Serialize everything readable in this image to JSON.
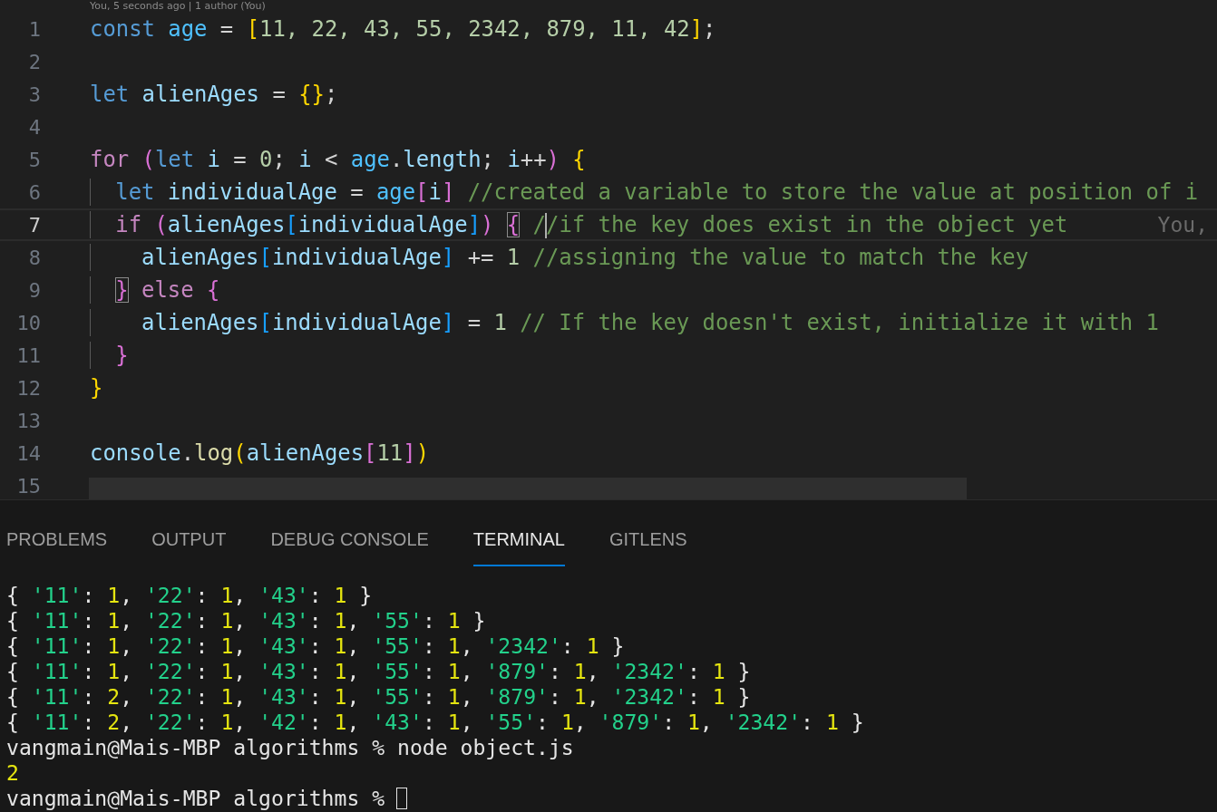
{
  "editor": {
    "codelens": "You, 5 seconds ago | 1 author (You)",
    "lines": [
      {
        "number": "1",
        "active": false,
        "tokens": [
          {
            "text": "const",
            "kind": "keyword"
          },
          {
            "text": " age",
            "kind": "constant"
          },
          {
            "text": " = ",
            "kind": "plain"
          },
          {
            "text": "[",
            "kind": "bracket1"
          },
          {
            "text": "11, 22, 43, 55, 2342, 879, 11, 42",
            "kind": "number"
          },
          {
            "text": "]",
            "kind": "bracket1"
          },
          {
            "text": ";",
            "kind": "plain"
          }
        ]
      },
      {
        "number": "2",
        "active": false
      },
      {
        "number": "3",
        "active": false,
        "tokens": [
          {
            "text": "let",
            "kind": "keyword"
          },
          {
            "text": " alienAges",
            "kind": "variable"
          },
          {
            "text": " = ",
            "kind": "plain"
          },
          {
            "text": "{}",
            "kind": "bracket1"
          },
          {
            "text": ";",
            "kind": "plain"
          }
        ]
      },
      {
        "number": "4",
        "active": false
      },
      {
        "number": "5",
        "active": false,
        "tokens": [
          {
            "text": "for",
            "kind": "control"
          },
          {
            "text": " (",
            "kind": "bracket2"
          },
          {
            "text": "let",
            "kind": "keyword"
          },
          {
            "text": " i",
            "kind": "variable"
          },
          {
            "text": " = ",
            "kind": "plain"
          },
          {
            "text": "0",
            "kind": "number"
          },
          {
            "text": "; ",
            "kind": "plain"
          },
          {
            "text": "i",
            "kind": "variable"
          },
          {
            "text": " < ",
            "kind": "plain"
          },
          {
            "text": "age",
            "kind": "constant"
          },
          {
            "text": ".",
            "kind": "plain"
          },
          {
            "text": "length",
            "kind": "variable"
          },
          {
            "text": "; ",
            "kind": "plain"
          },
          {
            "text": "i",
            "kind": "variable"
          },
          {
            "text": "++",
            "kind": "plain"
          },
          {
            "text": ")",
            "kind": "bracket2"
          },
          {
            "text": " {",
            "kind": "bracket1"
          }
        ]
      },
      {
        "number": "6",
        "active": false,
        "guide": true,
        "tokens": [
          {
            "text": "let",
            "kind": "keyword"
          },
          {
            "text": " individualAge",
            "kind": "variable"
          },
          {
            "text": " = ",
            "kind": "plain"
          },
          {
            "text": "age",
            "kind": "constant"
          },
          {
            "text": "[",
            "kind": "bracket2"
          },
          {
            "text": "i",
            "kind": "variable"
          },
          {
            "text": "]",
            "kind": "bracket2"
          },
          {
            "text": " //created a variable to store the value at position of i",
            "kind": "comment"
          }
        ]
      },
      {
        "number": "7",
        "active": true,
        "guide": true,
        "blame": "You,",
        "tokens": [
          {
            "text": "if",
            "kind": "control"
          },
          {
            "text": " (",
            "kind": "bracket2"
          },
          {
            "text": "alienAges",
            "kind": "variable"
          },
          {
            "text": "[",
            "kind": "bracket3"
          },
          {
            "text": "individualAge",
            "kind": "variable"
          },
          {
            "text": "]",
            "kind": "bracket3"
          },
          {
            "text": ") ",
            "kind": "bracket2"
          },
          {
            "text": "{",
            "kind": "bracket2",
            "matched": true
          },
          {
            "text": " /",
            "kind": "comment",
            "cursor_after": true
          },
          {
            "text": "/if the key does exist in the object yet",
            "kind": "comment"
          }
        ]
      },
      {
        "number": "8",
        "active": false,
        "guide": true,
        "tokens": [
          {
            "text": "  alienAges",
            "kind": "variable"
          },
          {
            "text": "[",
            "kind": "bracket3"
          },
          {
            "text": "individualAge",
            "kind": "variable"
          },
          {
            "text": "]",
            "kind": "bracket3"
          },
          {
            "text": " += ",
            "kind": "plain"
          },
          {
            "text": "1",
            "kind": "number"
          },
          {
            "text": " //assigning the value to match the key",
            "kind": "comment"
          }
        ]
      },
      {
        "number": "9",
        "active": false,
        "guide": true,
        "tokens": [
          {
            "text": "}",
            "kind": "bracket2",
            "matched": true
          },
          {
            "text": " else",
            "kind": "control"
          },
          {
            "text": " {",
            "kind": "bracket2"
          }
        ]
      },
      {
        "number": "10",
        "active": false,
        "guide": true,
        "tokens": [
          {
            "text": "  alienAges",
            "kind": "variable"
          },
          {
            "text": "[",
            "kind": "bracket3"
          },
          {
            "text": "individualAge",
            "kind": "variable"
          },
          {
            "text": "]",
            "kind": "bracket3"
          },
          {
            "text": " = ",
            "kind": "plain"
          },
          {
            "text": "1",
            "kind": "number"
          },
          {
            "text": " // If the key doesn't exist, initialize it with 1",
            "kind": "comment"
          }
        ]
      },
      {
        "number": "11",
        "active": false,
        "guide": true,
        "tokens": [
          {
            "text": "}",
            "kind": "bracket2"
          }
        ]
      },
      {
        "number": "12",
        "active": false,
        "tokens": [
          {
            "text": "}",
            "kind": "bracket1"
          }
        ]
      },
      {
        "number": "13",
        "active": false
      },
      {
        "number": "14",
        "active": false,
        "tokens": [
          {
            "text": "console",
            "kind": "variable"
          },
          {
            "text": ".",
            "kind": "plain"
          },
          {
            "text": "log",
            "kind": "function"
          },
          {
            "text": "(",
            "kind": "bracket1"
          },
          {
            "text": "alienAges",
            "kind": "variable"
          },
          {
            "text": "[",
            "kind": "bracket2"
          },
          {
            "text": "11",
            "kind": "number"
          },
          {
            "text": "]",
            "kind": "bracket2"
          },
          {
            "text": ")",
            "kind": "bracket1"
          }
        ]
      },
      {
        "number": "15",
        "active": false
      }
    ]
  },
  "panel": {
    "tabs": [
      {
        "label": "PROBLEMS",
        "selected": false
      },
      {
        "label": "OUTPUT",
        "selected": false
      },
      {
        "label": "DEBUG CONSOLE",
        "selected": false
      },
      {
        "label": "TERMINAL",
        "selected": true
      },
      {
        "label": "GITLENS",
        "selected": false
      }
    ],
    "terminal": [
      {
        "tokens": [
          {
            "text": "{ ",
            "kind": "plain"
          },
          {
            "text": "'11'",
            "kind": "string"
          },
          {
            "text": ": ",
            "kind": "plain"
          },
          {
            "text": "1",
            "kind": "number"
          },
          {
            "text": ", ",
            "kind": "plain"
          },
          {
            "text": "'22'",
            "kind": "string"
          },
          {
            "text": ": ",
            "kind": "plain"
          },
          {
            "text": "1",
            "kind": "number"
          },
          {
            "text": ", ",
            "kind": "plain"
          },
          {
            "text": "'43'",
            "kind": "string"
          },
          {
            "text": ": ",
            "kind": "plain"
          },
          {
            "text": "1",
            "kind": "number"
          },
          {
            "text": " }",
            "kind": "plain"
          }
        ]
      },
      {
        "tokens": [
          {
            "text": "{ ",
            "kind": "plain"
          },
          {
            "text": "'11'",
            "kind": "string"
          },
          {
            "text": ": ",
            "kind": "plain"
          },
          {
            "text": "1",
            "kind": "number"
          },
          {
            "text": ", ",
            "kind": "plain"
          },
          {
            "text": "'22'",
            "kind": "string"
          },
          {
            "text": ": ",
            "kind": "plain"
          },
          {
            "text": "1",
            "kind": "number"
          },
          {
            "text": ", ",
            "kind": "plain"
          },
          {
            "text": "'43'",
            "kind": "string"
          },
          {
            "text": ": ",
            "kind": "plain"
          },
          {
            "text": "1",
            "kind": "number"
          },
          {
            "text": ", ",
            "kind": "plain"
          },
          {
            "text": "'55'",
            "kind": "string"
          },
          {
            "text": ": ",
            "kind": "plain"
          },
          {
            "text": "1",
            "kind": "number"
          },
          {
            "text": " }",
            "kind": "plain"
          }
        ]
      },
      {
        "tokens": [
          {
            "text": "{ ",
            "kind": "plain"
          },
          {
            "text": "'11'",
            "kind": "string"
          },
          {
            "text": ": ",
            "kind": "plain"
          },
          {
            "text": "1",
            "kind": "number"
          },
          {
            "text": ", ",
            "kind": "plain"
          },
          {
            "text": "'22'",
            "kind": "string"
          },
          {
            "text": ": ",
            "kind": "plain"
          },
          {
            "text": "1",
            "kind": "number"
          },
          {
            "text": ", ",
            "kind": "plain"
          },
          {
            "text": "'43'",
            "kind": "string"
          },
          {
            "text": ": ",
            "kind": "plain"
          },
          {
            "text": "1",
            "kind": "number"
          },
          {
            "text": ", ",
            "kind": "plain"
          },
          {
            "text": "'55'",
            "kind": "string"
          },
          {
            "text": ": ",
            "kind": "plain"
          },
          {
            "text": "1",
            "kind": "number"
          },
          {
            "text": ", ",
            "kind": "plain"
          },
          {
            "text": "'2342'",
            "kind": "string"
          },
          {
            "text": ": ",
            "kind": "plain"
          },
          {
            "text": "1",
            "kind": "number"
          },
          {
            "text": " }",
            "kind": "plain"
          }
        ]
      },
      {
        "tokens": [
          {
            "text": "{ ",
            "kind": "plain"
          },
          {
            "text": "'11'",
            "kind": "string"
          },
          {
            "text": ": ",
            "kind": "plain"
          },
          {
            "text": "1",
            "kind": "number"
          },
          {
            "text": ", ",
            "kind": "plain"
          },
          {
            "text": "'22'",
            "kind": "string"
          },
          {
            "text": ": ",
            "kind": "plain"
          },
          {
            "text": "1",
            "kind": "number"
          },
          {
            "text": ", ",
            "kind": "plain"
          },
          {
            "text": "'43'",
            "kind": "string"
          },
          {
            "text": ": ",
            "kind": "plain"
          },
          {
            "text": "1",
            "kind": "number"
          },
          {
            "text": ", ",
            "kind": "plain"
          },
          {
            "text": "'55'",
            "kind": "string"
          },
          {
            "text": ": ",
            "kind": "plain"
          },
          {
            "text": "1",
            "kind": "number"
          },
          {
            "text": ", ",
            "kind": "plain"
          },
          {
            "text": "'879'",
            "kind": "string"
          },
          {
            "text": ": ",
            "kind": "plain"
          },
          {
            "text": "1",
            "kind": "number"
          },
          {
            "text": ", ",
            "kind": "plain"
          },
          {
            "text": "'2342'",
            "kind": "string"
          },
          {
            "text": ": ",
            "kind": "plain"
          },
          {
            "text": "1",
            "kind": "number"
          },
          {
            "text": " }",
            "kind": "plain"
          }
        ]
      },
      {
        "tokens": [
          {
            "text": "{ ",
            "kind": "plain"
          },
          {
            "text": "'11'",
            "kind": "string"
          },
          {
            "text": ": ",
            "kind": "plain"
          },
          {
            "text": "2",
            "kind": "number"
          },
          {
            "text": ", ",
            "kind": "plain"
          },
          {
            "text": "'22'",
            "kind": "string"
          },
          {
            "text": ": ",
            "kind": "plain"
          },
          {
            "text": "1",
            "kind": "number"
          },
          {
            "text": ", ",
            "kind": "plain"
          },
          {
            "text": "'43'",
            "kind": "string"
          },
          {
            "text": ": ",
            "kind": "plain"
          },
          {
            "text": "1",
            "kind": "number"
          },
          {
            "text": ", ",
            "kind": "plain"
          },
          {
            "text": "'55'",
            "kind": "string"
          },
          {
            "text": ": ",
            "kind": "plain"
          },
          {
            "text": "1",
            "kind": "number"
          },
          {
            "text": ", ",
            "kind": "plain"
          },
          {
            "text": "'879'",
            "kind": "string"
          },
          {
            "text": ": ",
            "kind": "plain"
          },
          {
            "text": "1",
            "kind": "number"
          },
          {
            "text": ", ",
            "kind": "plain"
          },
          {
            "text": "'2342'",
            "kind": "string"
          },
          {
            "text": ": ",
            "kind": "plain"
          },
          {
            "text": "1",
            "kind": "number"
          },
          {
            "text": " }",
            "kind": "plain"
          }
        ]
      },
      {
        "tokens": [
          {
            "text": "{ ",
            "kind": "plain"
          },
          {
            "text": "'11'",
            "kind": "string"
          },
          {
            "text": ": ",
            "kind": "plain"
          },
          {
            "text": "2",
            "kind": "number"
          },
          {
            "text": ", ",
            "kind": "plain"
          },
          {
            "text": "'22'",
            "kind": "string"
          },
          {
            "text": ": ",
            "kind": "plain"
          },
          {
            "text": "1",
            "kind": "number"
          },
          {
            "text": ", ",
            "kind": "plain"
          },
          {
            "text": "'42'",
            "kind": "string"
          },
          {
            "text": ": ",
            "kind": "plain"
          },
          {
            "text": "1",
            "kind": "number"
          },
          {
            "text": ", ",
            "kind": "plain"
          },
          {
            "text": "'43'",
            "kind": "string"
          },
          {
            "text": ": ",
            "kind": "plain"
          },
          {
            "text": "1",
            "kind": "number"
          },
          {
            "text": ", ",
            "kind": "plain"
          },
          {
            "text": "'55'",
            "kind": "string"
          },
          {
            "text": ": ",
            "kind": "plain"
          },
          {
            "text": "1",
            "kind": "number"
          },
          {
            "text": ", ",
            "kind": "plain"
          },
          {
            "text": "'879'",
            "kind": "string"
          },
          {
            "text": ": ",
            "kind": "plain"
          },
          {
            "text": "1",
            "kind": "number"
          },
          {
            "text": ", ",
            "kind": "plain"
          },
          {
            "text": "'2342'",
            "kind": "string"
          },
          {
            "text": ": ",
            "kind": "plain"
          },
          {
            "text": "1",
            "kind": "number"
          },
          {
            "text": " }",
            "kind": "plain"
          }
        ]
      },
      {
        "tokens": [
          {
            "text": "vangmain@Mais-MBP algorithms % node object.js",
            "kind": "plain"
          }
        ]
      },
      {
        "tokens": [
          {
            "text": "2",
            "kind": "number"
          }
        ]
      },
      {
        "cursor": true,
        "tokens": [
          {
            "text": "vangmain@Mais-MBP algorithms %",
            "kind": "plain"
          }
        ]
      }
    ]
  }
}
